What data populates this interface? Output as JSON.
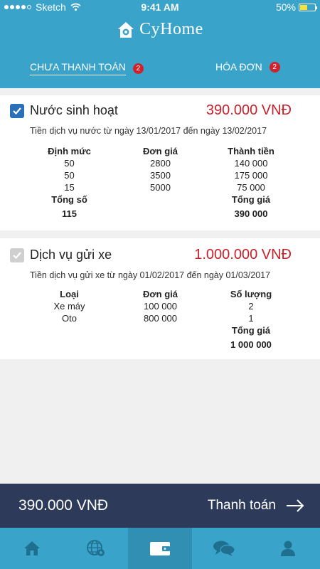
{
  "status_bar": {
    "carrier": "Sketch",
    "time": "9:41 AM",
    "battery": "50%",
    "battery_level": 0.5
  },
  "app": {
    "name": "CyHome"
  },
  "tabs": [
    {
      "label": "CHƯA THANH TOÁN",
      "badge": "2",
      "active": true
    },
    {
      "label": "HÓA ĐƠN",
      "badge": "2",
      "active": false
    }
  ],
  "bills": [
    {
      "name": "Nước sinh hoạt",
      "checked": true,
      "amount": "390.000 VNĐ",
      "description": "Tiền dịch vụ nước từ ngày 13/01/2017 đến ngày 13/02/2017",
      "headers": [
        "Định mức",
        "Đơn giá",
        "Thành tiền"
      ],
      "col1": [
        "50",
        "50",
        "15"
      ],
      "col2": [
        "2800",
        "3500",
        "5000"
      ],
      "col3": [
        "140 000",
        "175 000",
        "75 000"
      ],
      "total_label_left": "Tổng số",
      "total_value_left": "115",
      "total_label_right": "Tổng giá",
      "total_value_right": "390 000"
    },
    {
      "name": "Dịch vụ gửi xe",
      "checked": false,
      "amount": "1.000.000 VNĐ",
      "description": "Tiền dịch vụ gửi xe từ ngày 01/02/2017 đến ngày 01/03/2017",
      "headers": [
        "Loại",
        "Đơn giá",
        "Số lượng"
      ],
      "col1": [
        "Xe máy",
        "Oto"
      ],
      "col2": [
        "100 000",
        "800 000"
      ],
      "col3": [
        "2",
        "1"
      ],
      "total_label_right": "Tổng giá",
      "total_value_right": "1 000 000"
    }
  ],
  "paybar": {
    "total": "390.000 VNĐ",
    "button_label": "Thanh toán"
  },
  "bottom_nav": [
    "home-icon",
    "globe-settings-icon",
    "wallet-icon",
    "chat-icon",
    "user-icon"
  ],
  "colors": {
    "primary": "#3aa3c9",
    "paybar": "#2d3a59",
    "amount": "#c9202a",
    "badge": "#d0222b",
    "checkbox": "#2a6fb8"
  }
}
